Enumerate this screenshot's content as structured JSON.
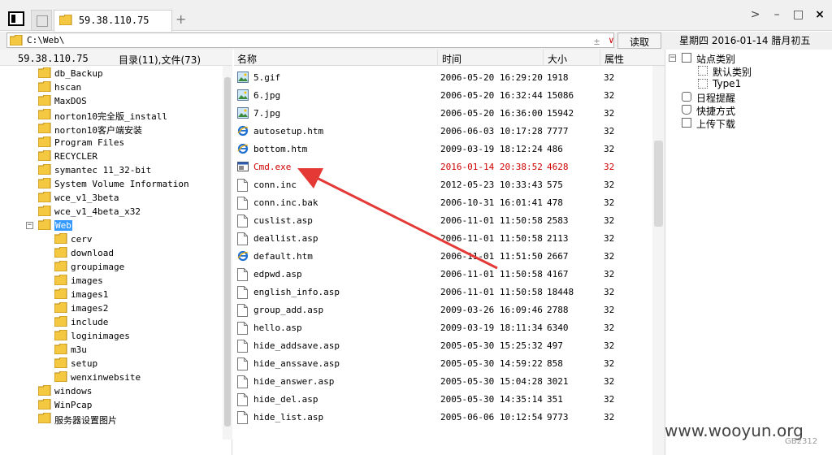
{
  "tabbar": {
    "tab_title": "59.38.110.75",
    "new_tab": "+",
    "chevron": ">",
    "minimize": "–",
    "maximize": "□",
    "close": "×"
  },
  "addressbar": {
    "path": "C:\\Web\\",
    "pin": "±",
    "dropdown": "∨",
    "read_button": "读取",
    "date": "星期四 2016-01-14 腊月初五"
  },
  "left_panel": {
    "host": "59.38.110.75",
    "count": "目录(11),文件(73)",
    "tree": [
      {
        "label": "db_Backup",
        "level": 0
      },
      {
        "label": "hscan",
        "level": 0
      },
      {
        "label": "MaxDOS",
        "level": 0
      },
      {
        "label": "norton10完全版_install",
        "level": 0
      },
      {
        "label": "norton10客户端安装",
        "level": 0
      },
      {
        "label": "Program Files",
        "level": 0
      },
      {
        "label": "RECYCLER",
        "level": 0
      },
      {
        "label": "symantec 11_32-bit",
        "level": 0
      },
      {
        "label": "System Volume Information",
        "level": 0
      },
      {
        "label": "wce_v1_3beta",
        "level": 0
      },
      {
        "label": "wce_v1_4beta_x32",
        "level": 0
      },
      {
        "label": "Web",
        "level": 0,
        "expanded": true,
        "selected": true
      },
      {
        "label": "cerv",
        "level": 1
      },
      {
        "label": "download",
        "level": 1
      },
      {
        "label": "groupimage",
        "level": 1
      },
      {
        "label": "images",
        "level": 1
      },
      {
        "label": "images1",
        "level": 1
      },
      {
        "label": "images2",
        "level": 1
      },
      {
        "label": "include",
        "level": 1
      },
      {
        "label": "loginimages",
        "level": 1
      },
      {
        "label": "m3u",
        "level": 1
      },
      {
        "label": "setup",
        "level": 1
      },
      {
        "label": "wenxinwebsite",
        "level": 1
      },
      {
        "label": "windows",
        "level": 0
      },
      {
        "label": "WinPcap",
        "level": 0
      },
      {
        "label": "服务器设置图片",
        "level": 0
      }
    ]
  },
  "file_list": {
    "headers": {
      "name": "名称",
      "time": "时间",
      "size": "大小",
      "attr": "属性"
    },
    "rows": [
      {
        "name": "5.gif",
        "time": "2006-05-20 16:29:20",
        "size": "1918",
        "attr": "32",
        "icon": "image-icon"
      },
      {
        "name": "6.jpg",
        "time": "2006-05-20 16:32:44",
        "size": "15086",
        "attr": "32",
        "icon": "image-icon"
      },
      {
        "name": "7.jpg",
        "time": "2006-05-20 16:36:00",
        "size": "15942",
        "attr": "32",
        "icon": "image-icon"
      },
      {
        "name": "autosetup.htm",
        "time": "2006-06-03 10:17:28",
        "size": "7777",
        "attr": "32",
        "icon": "ie-icon"
      },
      {
        "name": "bottom.htm",
        "time": "2009-03-19 18:12:24",
        "size": "486",
        "attr": "32",
        "icon": "ie-icon"
      },
      {
        "name": "Cmd.exe",
        "time": "2016-01-14 20:38:52",
        "size": "4628",
        "attr": "32",
        "icon": "exe-icon",
        "highlight": true
      },
      {
        "name": "conn.inc",
        "time": "2012-05-23 10:33:43",
        "size": "575",
        "attr": "32",
        "icon": "file-icon"
      },
      {
        "name": "conn.inc.bak",
        "time": "2006-10-31 16:01:41",
        "size": "478",
        "attr": "32",
        "icon": "file-icon"
      },
      {
        "name": "cuslist.asp",
        "time": "2006-11-01 11:50:58",
        "size": "2583",
        "attr": "32",
        "icon": "file-icon"
      },
      {
        "name": "deallist.asp",
        "time": "2006-11-01 11:50:58",
        "size": "2113",
        "attr": "32",
        "icon": "file-icon"
      },
      {
        "name": "default.htm",
        "time": "2006-11-01 11:51:50",
        "size": "2667",
        "attr": "32",
        "icon": "ie-icon"
      },
      {
        "name": "edpwd.asp",
        "time": "2006-11-01 11:50:58",
        "size": "4167",
        "attr": "32",
        "icon": "file-icon"
      },
      {
        "name": "english_info.asp",
        "time": "2006-11-01 11:50:58",
        "size": "18448",
        "attr": "32",
        "icon": "file-icon"
      },
      {
        "name": "group_add.asp",
        "time": "2009-03-26 16:09:46",
        "size": "2788",
        "attr": "32",
        "icon": "file-icon"
      },
      {
        "name": "hello.asp",
        "time": "2009-03-19 18:11:34",
        "size": "6340",
        "attr": "32",
        "icon": "file-icon"
      },
      {
        "name": "hide_addsave.asp",
        "time": "2005-05-30 15:25:32",
        "size": "497",
        "attr": "32",
        "icon": "file-icon"
      },
      {
        "name": "hide_anssave.asp",
        "time": "2005-05-30 14:59:22",
        "size": "858",
        "attr": "32",
        "icon": "file-icon"
      },
      {
        "name": "hide_answer.asp",
        "time": "2005-05-30 15:04:28",
        "size": "3021",
        "attr": "32",
        "icon": "file-icon"
      },
      {
        "name": "hide_del.asp",
        "time": "2005-05-30 14:35:14",
        "size": "351",
        "attr": "32",
        "icon": "file-icon"
      },
      {
        "name": "hide_list.asp",
        "time": "2005-06-06 10:12:54",
        "size": "9773",
        "attr": "32",
        "icon": "file-icon"
      }
    ]
  },
  "right_panel": {
    "items": [
      {
        "label": "站点类别",
        "expander": "⊟"
      },
      {
        "label": "默认类别"
      },
      {
        "label": "Type1"
      },
      {
        "label": "日程提醒"
      },
      {
        "label": "快捷方式"
      },
      {
        "label": "上传下载"
      }
    ]
  },
  "watermark": "www.wooyun.org",
  "encoding": "GB2312",
  "colors": {
    "selection": "#3399ff",
    "highlight_text": "#d00000",
    "arrow": "#e53935",
    "folder": "#f5c842"
  }
}
